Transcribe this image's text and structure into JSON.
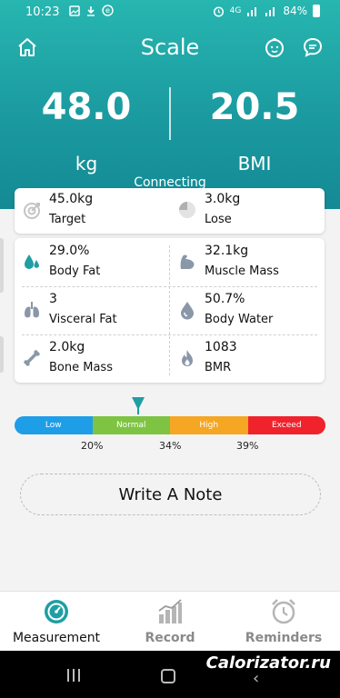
{
  "status_bar": {
    "time": "10:23",
    "network": "4G",
    "battery": "84%"
  },
  "header": {
    "title": "Scale"
  },
  "metrics": {
    "weight": {
      "value": "48.0",
      "unit": "kg"
    },
    "bmi": {
      "value": "20.5",
      "unit": "BMI"
    },
    "status": "Connecting"
  },
  "target": {
    "target_value": "45.0kg",
    "target_label": "Target",
    "lose_value": "3.0kg",
    "lose_label": "Lose"
  },
  "stats": [
    {
      "value": "29.0%",
      "label": "Body Fat",
      "icon": "drops-icon",
      "color": "#1f9ea3"
    },
    {
      "value": "32.1kg",
      "label": "Muscle Mass",
      "icon": "muscle-icon",
      "color": "#8a97a8"
    },
    {
      "value": "3",
      "label": "Visceral Fat",
      "icon": "lungs-icon",
      "color": "#8a97a8"
    },
    {
      "value": "50.7%",
      "label": "Body Water",
      "icon": "water-drop-icon",
      "color": "#8a97a8"
    },
    {
      "value": "2.0kg",
      "label": "Bone Mass",
      "icon": "bone-icon",
      "color": "#8a97a8"
    },
    {
      "value": "1083",
      "label": "BMR",
      "icon": "flame-icon",
      "color": "#8a97a8"
    }
  ],
  "range_bar": {
    "segments": [
      {
        "label": "Low",
        "color": "#1f9ee8"
      },
      {
        "label": "Normal",
        "color": "#7ec442"
      },
      {
        "label": "High",
        "color": "#f5a623"
      },
      {
        "label": "Exceed",
        "color": "#f0222c"
      }
    ],
    "ticks": [
      "20%",
      "34%",
      "39%"
    ],
    "marker_value_percent": 29.0
  },
  "note_button": "Write A Note",
  "bottom_nav": {
    "measurement": "Measurement",
    "record": "Record",
    "reminders": "Reminders"
  },
  "watermark": "Calorizator.ru",
  "colors": {
    "accent": "#1f9ea3",
    "header_top": "#27b6b0",
    "header_bottom": "#148a94"
  }
}
